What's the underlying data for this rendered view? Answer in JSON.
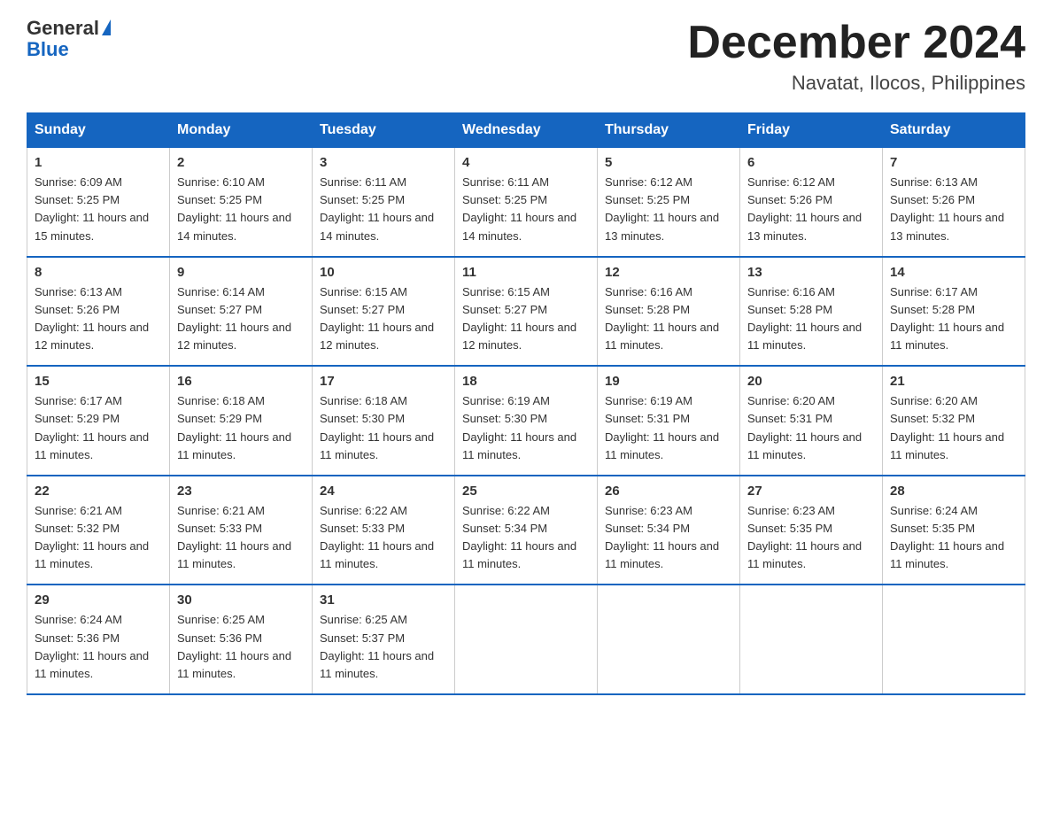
{
  "logo": {
    "general": "General",
    "blue": "Blue"
  },
  "title": "December 2024",
  "location": "Navatat, Ilocos, Philippines",
  "days_of_week": [
    "Sunday",
    "Monday",
    "Tuesday",
    "Wednesday",
    "Thursday",
    "Friday",
    "Saturday"
  ],
  "weeks": [
    [
      {
        "day": "1",
        "sunrise": "6:09 AM",
        "sunset": "5:25 PM",
        "daylight": "11 hours and 15 minutes."
      },
      {
        "day": "2",
        "sunrise": "6:10 AM",
        "sunset": "5:25 PM",
        "daylight": "11 hours and 14 minutes."
      },
      {
        "day": "3",
        "sunrise": "6:11 AM",
        "sunset": "5:25 PM",
        "daylight": "11 hours and 14 minutes."
      },
      {
        "day": "4",
        "sunrise": "6:11 AM",
        "sunset": "5:25 PM",
        "daylight": "11 hours and 14 minutes."
      },
      {
        "day": "5",
        "sunrise": "6:12 AM",
        "sunset": "5:25 PM",
        "daylight": "11 hours and 13 minutes."
      },
      {
        "day": "6",
        "sunrise": "6:12 AM",
        "sunset": "5:26 PM",
        "daylight": "11 hours and 13 minutes."
      },
      {
        "day": "7",
        "sunrise": "6:13 AM",
        "sunset": "5:26 PM",
        "daylight": "11 hours and 13 minutes."
      }
    ],
    [
      {
        "day": "8",
        "sunrise": "6:13 AM",
        "sunset": "5:26 PM",
        "daylight": "11 hours and 12 minutes."
      },
      {
        "day": "9",
        "sunrise": "6:14 AM",
        "sunset": "5:27 PM",
        "daylight": "11 hours and 12 minutes."
      },
      {
        "day": "10",
        "sunrise": "6:15 AM",
        "sunset": "5:27 PM",
        "daylight": "11 hours and 12 minutes."
      },
      {
        "day": "11",
        "sunrise": "6:15 AM",
        "sunset": "5:27 PM",
        "daylight": "11 hours and 12 minutes."
      },
      {
        "day": "12",
        "sunrise": "6:16 AM",
        "sunset": "5:28 PM",
        "daylight": "11 hours and 11 minutes."
      },
      {
        "day": "13",
        "sunrise": "6:16 AM",
        "sunset": "5:28 PM",
        "daylight": "11 hours and 11 minutes."
      },
      {
        "day": "14",
        "sunrise": "6:17 AM",
        "sunset": "5:28 PM",
        "daylight": "11 hours and 11 minutes."
      }
    ],
    [
      {
        "day": "15",
        "sunrise": "6:17 AM",
        "sunset": "5:29 PM",
        "daylight": "11 hours and 11 minutes."
      },
      {
        "day": "16",
        "sunrise": "6:18 AM",
        "sunset": "5:29 PM",
        "daylight": "11 hours and 11 minutes."
      },
      {
        "day": "17",
        "sunrise": "6:18 AM",
        "sunset": "5:30 PM",
        "daylight": "11 hours and 11 minutes."
      },
      {
        "day": "18",
        "sunrise": "6:19 AM",
        "sunset": "5:30 PM",
        "daylight": "11 hours and 11 minutes."
      },
      {
        "day": "19",
        "sunrise": "6:19 AM",
        "sunset": "5:31 PM",
        "daylight": "11 hours and 11 minutes."
      },
      {
        "day": "20",
        "sunrise": "6:20 AM",
        "sunset": "5:31 PM",
        "daylight": "11 hours and 11 minutes."
      },
      {
        "day": "21",
        "sunrise": "6:20 AM",
        "sunset": "5:32 PM",
        "daylight": "11 hours and 11 minutes."
      }
    ],
    [
      {
        "day": "22",
        "sunrise": "6:21 AM",
        "sunset": "5:32 PM",
        "daylight": "11 hours and 11 minutes."
      },
      {
        "day": "23",
        "sunrise": "6:21 AM",
        "sunset": "5:33 PM",
        "daylight": "11 hours and 11 minutes."
      },
      {
        "day": "24",
        "sunrise": "6:22 AM",
        "sunset": "5:33 PM",
        "daylight": "11 hours and 11 minutes."
      },
      {
        "day": "25",
        "sunrise": "6:22 AM",
        "sunset": "5:34 PM",
        "daylight": "11 hours and 11 minutes."
      },
      {
        "day": "26",
        "sunrise": "6:23 AM",
        "sunset": "5:34 PM",
        "daylight": "11 hours and 11 minutes."
      },
      {
        "day": "27",
        "sunrise": "6:23 AM",
        "sunset": "5:35 PM",
        "daylight": "11 hours and 11 minutes."
      },
      {
        "day": "28",
        "sunrise": "6:24 AM",
        "sunset": "5:35 PM",
        "daylight": "11 hours and 11 minutes."
      }
    ],
    [
      {
        "day": "29",
        "sunrise": "6:24 AM",
        "sunset": "5:36 PM",
        "daylight": "11 hours and 11 minutes."
      },
      {
        "day": "30",
        "sunrise": "6:25 AM",
        "sunset": "5:36 PM",
        "daylight": "11 hours and 11 minutes."
      },
      {
        "day": "31",
        "sunrise": "6:25 AM",
        "sunset": "5:37 PM",
        "daylight": "11 hours and 11 minutes."
      },
      null,
      null,
      null,
      null
    ]
  ]
}
